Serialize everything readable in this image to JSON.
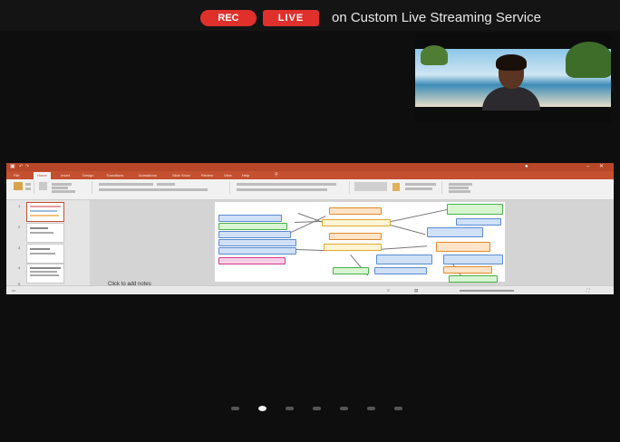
{
  "recording": {
    "rec_label": "REC",
    "live_label": "LIVE",
    "stream_text": "on Custom Live Streaming Service"
  },
  "colors": {
    "rec_red": "#e0302c",
    "ppt_orange": "#c4502f",
    "background": "#0e0e0e"
  },
  "video": {
    "icon": "participant-video"
  },
  "shared_screen": {
    "app": "PowerPoint",
    "tabs": [
      "File",
      "Home",
      "Insert",
      "Design",
      "Transitions",
      "Animations",
      "Slide Show",
      "Review",
      "View",
      "Help"
    ],
    "notes_placeholder": "Click to add notes",
    "slide_numbers": [
      "1",
      "2",
      "3",
      "4",
      "5"
    ]
  },
  "pagination": {
    "count": 7,
    "active_index": 1
  }
}
